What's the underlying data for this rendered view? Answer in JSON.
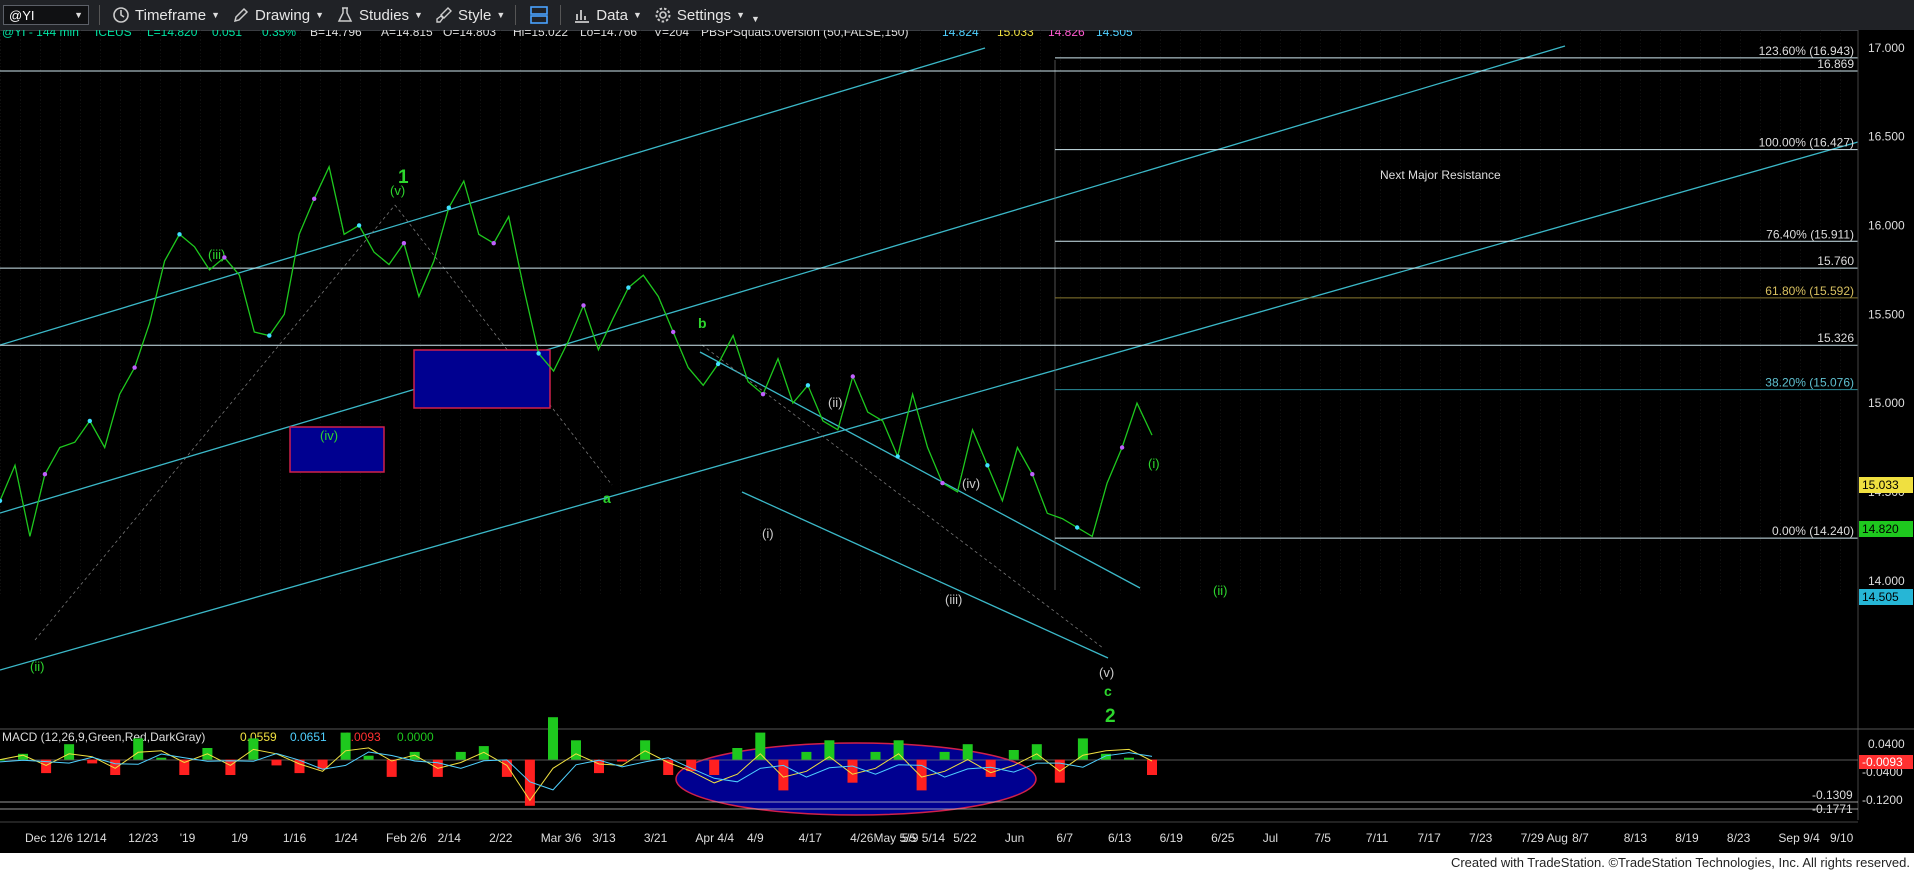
{
  "toolbar": {
    "symbol": "@YI",
    "timeframe_label": "Timeframe",
    "drawing_label": "Drawing",
    "studies_label": "Studies",
    "style_label": "Style",
    "data_label": "Data",
    "settings_label": "Settings"
  },
  "header": {
    "symbol": "@YI - 144 min",
    "exchange": "ICEUS",
    "last": "L=14.820",
    "change": "0.051",
    "pct": "0.35%",
    "bid": "B=14.796",
    "ask": "A=14.815",
    "open": "O=14.803",
    "high": "Hi=15.022",
    "low": "Lo=14.766",
    "volume": "V=204",
    "study": "PBSPSquat5.0version (50,FALSE,150)",
    "study_vals": [
      "14.824",
      "15.033",
      "14.826",
      "14.505"
    ]
  },
  "chart_data": [
    {
      "type": "line",
      "title": "@YI - 144 min",
      "ylim": [
        13.92,
        17.1
      ],
      "y_ticks": [
        "17.000",
        "16.500",
        "16.000",
        "15.500",
        "15.000",
        "14.500",
        "14.000"
      ],
      "x_ticks": [
        "Dec 12/6",
        "12/14",
        "12/23",
        "'19",
        "1/9",
        "1/16",
        "1/24",
        "Feb 2/6",
        "2/14",
        "2/22",
        "Mar 3/6",
        "3/13",
        "3/21",
        "Apr 4/4",
        "4/9",
        "4/17",
        "4/26May 5/5",
        "5/9 5/14",
        "5/22",
        "Jun",
        "6/7",
        "6/13",
        "6/19",
        "6/25",
        "Jul",
        "7/5",
        "7/11",
        "7/17",
        "7/23",
        "7/29 Aug",
        "8/7",
        "8/13",
        "8/19",
        "8/23",
        "Sep 9/4",
        "9/10"
      ],
      "series": [
        {
          "values": [
            14.45,
            14.65,
            14.25,
            14.6,
            14.75,
            14.78,
            14.9,
            14.75,
            15.05,
            15.2,
            15.45,
            15.8,
            15.95,
            15.88,
            15.75,
            15.82,
            15.72,
            15.4,
            15.38,
            15.5,
            15.95,
            16.15,
            16.33,
            15.95,
            16.0,
            15.85,
            15.78,
            15.9,
            15.6,
            15.8,
            16.1,
            16.25,
            15.95,
            15.9,
            16.05,
            15.65,
            15.28,
            15.18,
            15.35,
            15.55,
            15.3,
            15.48,
            15.65,
            15.72,
            15.6,
            15.4,
            15.2,
            15.1,
            15.22,
            15.38,
            15.12,
            15.05,
            15.25,
            15.0,
            15.1,
            14.9,
            14.85,
            15.15,
            14.95,
            14.9,
            14.7,
            15.05,
            14.75,
            14.55,
            14.5,
            14.85,
            14.65,
            14.45,
            14.75,
            14.6,
            14.38,
            14.35,
            14.3,
            14.25,
            14.55,
            14.75,
            15.0,
            14.82
          ]
        }
      ],
      "horizontal_levels": [
        {
          "value": 16.943,
          "label": "123.60% (16.943)"
        },
        {
          "value": 16.869,
          "label": "16.869"
        },
        {
          "value": 16.427,
          "label": "100.00% (16.427)"
        },
        {
          "value": 15.911,
          "label": "76.40% (15.911)"
        },
        {
          "value": 15.76,
          "label": "15.760"
        },
        {
          "value": 15.592,
          "label": "61.80% (15.592)"
        },
        {
          "value": 15.326,
          "label": "15.326"
        },
        {
          "value": 15.076,
          "label": "38.20% (15.076)"
        },
        {
          "value": 14.24,
          "label": "0.00% (14.240)"
        }
      ],
      "price_markers": [
        "15.033",
        "14.820",
        "14.505"
      ],
      "annotations": [
        "1",
        "(v)",
        "(iii)",
        "(iv)",
        "(ii)",
        "a",
        "b",
        "(i)",
        "(ii)",
        "(iii)",
        "(iv)",
        "(v)",
        "c",
        "2",
        "(i)",
        "(ii)",
        "Next Major Resistance"
      ]
    },
    {
      "type": "line",
      "title": "MACD (12,26,9,Green,Red,DarkGray)",
      "ylim": [
        -0.19,
        0.05
      ],
      "y_ticks": [
        "0.0400",
        "-0.0400",
        "-0.1200"
      ],
      "values_shown": [
        "0.0559",
        "0.0651",
        "-0.0093",
        "0.0000"
      ],
      "levels": [
        "-0.1309",
        "-0.1771"
      ],
      "marker": "-0.0093",
      "series": [
        {
          "values": [
            0.0,
            0.015,
            -0.02,
            0.02,
            0.01,
            -0.03,
            0.025,
            0.03,
            -0.01,
            0.02,
            -0.02,
            0.035,
            0.02,
            -0.015,
            -0.04,
            0.03,
            0.04,
            -0.005,
            0.015,
            -0.03,
            -0.01,
            0.025,
            -0.02,
            -0.14,
            -0.03,
            0.02,
            -0.015,
            -0.02,
            0.03,
            -0.01,
            -0.04,
            -0.08,
            -0.05,
            0.02,
            -0.06,
            -0.04,
            0.01,
            -0.05,
            -0.03,
            0.02,
            -0.06,
            -0.04,
            0.0,
            -0.045,
            -0.02,
            0.02,
            -0.04,
            0.015,
            0.03,
            0.035,
            -0.005
          ]
        }
      ]
    }
  ],
  "footer": "Created with TradeStation. ©TradeStation Technologies, Inc. All rights reserved."
}
